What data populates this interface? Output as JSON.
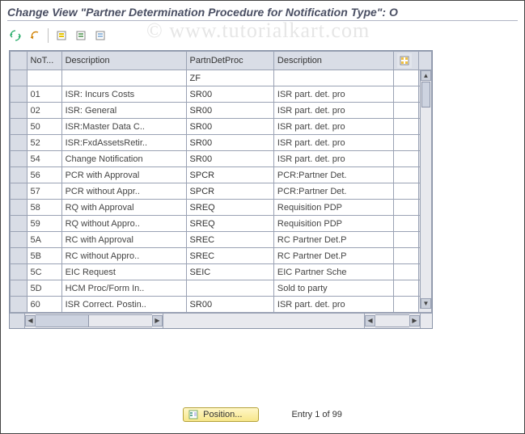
{
  "title": "Change View \"Partner Determination Procedure for Notification Type\": O",
  "watermark": "© www.tutorialkart.com",
  "toolbar": {
    "icons": [
      {
        "name": "toggle-icon",
        "title": "Change/Display"
      },
      {
        "name": "undo-icon",
        "title": "Other Entry"
      },
      {
        "name": "select-all-icon",
        "title": "Select All"
      },
      {
        "name": "save-icon",
        "title": "Save"
      },
      {
        "name": "deselect-all-icon",
        "title": "Deselect All"
      }
    ]
  },
  "columns": {
    "notType": "NoT...",
    "desc1": "Description",
    "pdp": "PartnDetProc",
    "desc2": "Description"
  },
  "rows": [
    {
      "not": "",
      "desc1": "",
      "pdp": "ZF",
      "desc2": ""
    },
    {
      "not": "01",
      "desc1": "ISR: Incurs Costs",
      "pdp": "SR00",
      "desc2": "ISR part. det. pro"
    },
    {
      "not": "02",
      "desc1": "ISR: General",
      "pdp": "SR00",
      "desc2": "ISR part. det. pro"
    },
    {
      "not": "50",
      "desc1": "ISR:Master Data C..",
      "pdp": "SR00",
      "desc2": "ISR part. det. pro"
    },
    {
      "not": "52",
      "desc1": "ISR:FxdAssetsRetir..",
      "pdp": "SR00",
      "desc2": "ISR part. det. pro"
    },
    {
      "not": "54",
      "desc1": "Change Notification",
      "pdp": "SR00",
      "desc2": "ISR part. det. pro"
    },
    {
      "not": "56",
      "desc1": "PCR with Approval",
      "pdp": "SPCR",
      "desc2": "PCR:Partner Det."
    },
    {
      "not": "57",
      "desc1": "PCR without Appr..",
      "pdp": "SPCR",
      "desc2": "PCR:Partner Det."
    },
    {
      "not": "58",
      "desc1": "RQ with Approval",
      "pdp": "SREQ",
      "desc2": "Requisition PDP"
    },
    {
      "not": "59",
      "desc1": "RQ without Appro..",
      "pdp": "SREQ",
      "desc2": "Requisition PDP"
    },
    {
      "not": "5A",
      "desc1": "RC with Approval",
      "pdp": "SREC",
      "desc2": "RC Partner Det.P"
    },
    {
      "not": "5B",
      "desc1": "RC without Appro..",
      "pdp": "SREC",
      "desc2": "RC Partner Det.P"
    },
    {
      "not": "5C",
      "desc1": "EIC Request",
      "pdp": "SEIC",
      "desc2": "EIC Partner Sche"
    },
    {
      "not": "5D",
      "desc1": "HCM Proc/Form In..",
      "pdp": "",
      "desc2": "Sold to party"
    },
    {
      "not": "60",
      "desc1": "ISR Correct. Postin..",
      "pdp": "SR00",
      "desc2": "ISR part. det. pro"
    }
  ],
  "footer": {
    "position_label": "Position...",
    "entry_text": "Entry 1 of 99"
  },
  "colors": {
    "header_bg": "#d9dde6",
    "border": "#9aa2b4",
    "accent_btn": "#f7e78a"
  }
}
